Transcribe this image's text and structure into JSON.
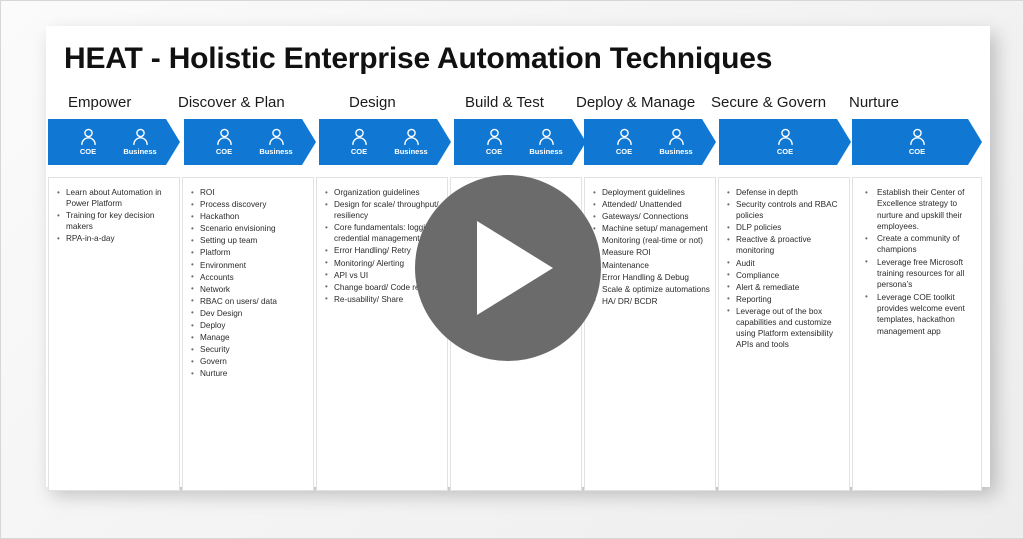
{
  "player": {
    "play_button_label": "Play",
    "accent_blue": "#1078d3",
    "overlay_gray": "#6b6b6b"
  },
  "slide": {
    "title": "HEAT - Holistic Enterprise Automation Techniques",
    "phases": [
      {
        "label": "Empower",
        "personas": [
          "COE",
          "Business"
        ],
        "items": [
          "Learn about Automation in Power Platform",
          "Training for key decision makers",
          "RPA-in-a-day"
        ]
      },
      {
        "label": "Discover & Plan",
        "personas": [
          "COE",
          "Business"
        ],
        "items": [
          "ROI",
          "Process discovery",
          "Hackathon",
          "Scenario envisioning",
          "Setting up team",
          "Platform",
          "Environment",
          "Accounts",
          "Network",
          "RBAC on users/ data",
          "Dev Design",
          "Deploy",
          "Manage",
          "Security",
          "Govern",
          "Nurture"
        ]
      },
      {
        "label": "Design",
        "personas": [
          "COE",
          "Business"
        ],
        "items": [
          "Organization guidelines",
          "Design for scale/ throughput/ resiliency",
          "Core fundamentals: logging/ credential management/ test",
          "Error Handling/ Retry",
          "Monitoring/ Alerting",
          "API vs UI",
          "Change board/ Code review",
          "Re-usability/ Share"
        ]
      },
      {
        "label": "Build & Test",
        "personas": [
          "COE",
          "Business"
        ],
        "items": []
      },
      {
        "label": "Deploy & Manage",
        "personas": [
          "COE",
          "Business"
        ],
        "items": [
          "Deployment guidelines",
          "Attended/ Unattended",
          "Gateways/ Connections",
          "Machine setup/ management",
          "Monitoring (real-time or not)",
          "Measure ROI",
          "Maintenance",
          "Error Handling & Debug",
          "Scale & optimize automations",
          "HA/ DR/ BCDR"
        ]
      },
      {
        "label": "Secure & Govern",
        "personas": [
          "COE"
        ],
        "items": [
          "Defense in depth",
          "Security controls and RBAC policies",
          "DLP policies",
          "Reactive & proactive monitoring",
          "Audit",
          "Compliance",
          "Alert & remediate",
          "Reporting",
          "Leverage out of the box capabilities and customize using Platform extensibility APIs and tools"
        ]
      },
      {
        "label": "Nurture",
        "personas": [
          "COE"
        ],
        "items": [
          "Establish their Center of Excellence strategy to nurture and upskill their employees.",
          "Create a community of champions",
          "Leverage free Microsoft training resources for all persona’s",
          "Leverage COE toolkit provides welcome event templates, hackathon management app"
        ]
      }
    ]
  }
}
